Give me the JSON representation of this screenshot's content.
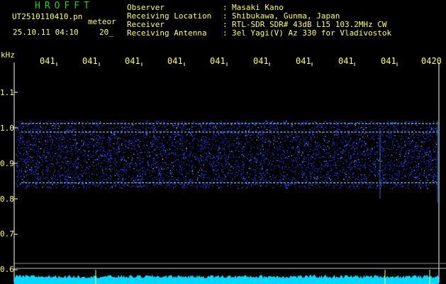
{
  "header": {
    "brand": "HROFFT",
    "file_name": "UT2510110410.pn",
    "file_suffix": "meteor",
    "date_time": "25.10.11 04:10",
    "date_suffix": "20_",
    "info": [
      {
        "label": "Observer",
        "colon": ":",
        "value": "Masaki Kano"
      },
      {
        "label": "Receiving Location",
        "colon": ":",
        "value": "Shibukawa, Gunma, Japan"
      },
      {
        "label": "Receiver",
        "colon": ":",
        "value": "RTL-SDR SDR# 43dB L15 103.2MHz CW"
      },
      {
        "label": "Receiving Antenna",
        "colon": ":",
        "value": "3el Yagi(V) Az 330 for Vladivostok"
      }
    ]
  },
  "spectrogram": {
    "y_unit": "kHz",
    "y_ticks": [
      "1.1",
      "1.0",
      "0.9",
      "0.8",
      "0.7",
      "0.6"
    ],
    "time_ticks": [
      "041",
      "041",
      "041",
      "041",
      "041",
      "041",
      "041",
      "041",
      "041",
      "0420"
    ],
    "band_range_khz": [
      0.83,
      1.02
    ],
    "bright_lines_khz": [
      1.012,
      0.988,
      0.845
    ],
    "colors": {
      "background": "#000000",
      "noise": "#1a2fd8",
      "line": "#7fd0ff",
      "axis": "#ffffff",
      "text": "#ffff55",
      "brand": "#1fd11f",
      "bottom_trace": "#00d8ff"
    }
  }
}
